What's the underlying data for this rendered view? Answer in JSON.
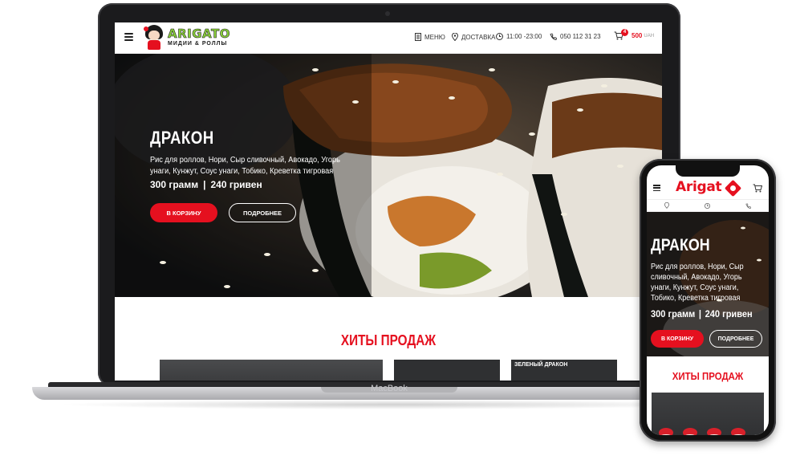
{
  "device_label": "MacBook",
  "header": {
    "logo_main": "ARIGATO",
    "logo_sub": "МИДИИ & РОЛЛЫ",
    "nav": [
      {
        "icon": "menu-doc-icon",
        "label": "МЕНЮ"
      },
      {
        "icon": "location-pin-icon",
        "label": "ДОСТАВКА"
      },
      {
        "icon": "clock-icon",
        "label": "11:00 -23:00"
      },
      {
        "icon": "phone-icon",
        "label": "050 112 31 23"
      }
    ],
    "cart": {
      "badge": "4",
      "price": "500",
      "currency": "UAH"
    }
  },
  "hero": {
    "title": "ДРАКОН",
    "description": "Рис для роллов, Нори, Сыр сливочный, Авокадо, Угорь унаги, Кунжут, Соус унаги, Тобико, Креветка тигровая",
    "weight": "300 грамм",
    "separator": "|",
    "price": "240 гривен",
    "cart_button": "В КОРЗИНУ",
    "more_button": "ПОДРОБНЕЕ"
  },
  "hits": {
    "title": "ХИТЫ ПРОДАЖ",
    "card3_label": "ЗЕЛЕНЫЙ ДРАКОН"
  },
  "phone": {
    "logo": "Arigat",
    "hero_title": "ДРАКОН",
    "hero_desc": "Рис для роллов, Нори, Сыр сливочный, Авокадо, Угорь унаги, Кунжут, Соус унаги, Тобико, Креветка тигровая",
    "weight": "300 грамм",
    "separator": "|",
    "price": "240 гривен",
    "cart_button": "В КОРЗИНУ",
    "more_button": "ПОДРОБНЕЕ",
    "hits_title": "ХИТЫ ПРОДАЖ"
  },
  "colors": {
    "accent": "#e5101f",
    "logo_green": "#8bd13b",
    "hero_bg": "#1c1d1e"
  }
}
